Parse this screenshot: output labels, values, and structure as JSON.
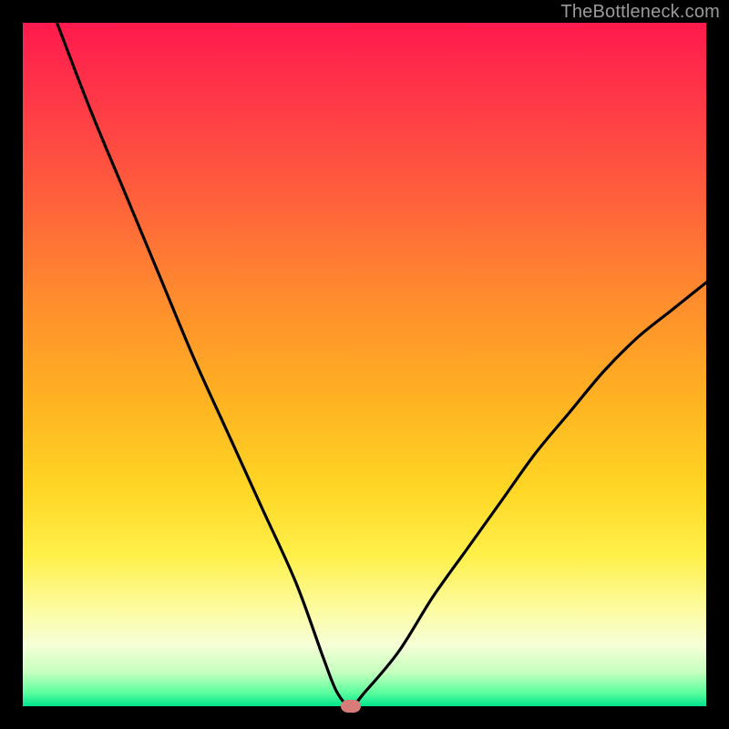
{
  "watermark": "TheBottleneck.com",
  "chart_data": {
    "type": "line",
    "title": "",
    "xlabel": "",
    "ylabel": "",
    "xlim": [
      0,
      100
    ],
    "ylim": [
      0,
      100
    ],
    "grid": false,
    "legend": false,
    "series": [
      {
        "name": "bottleneck-curve",
        "x": [
          5,
          10,
          15,
          20,
          25,
          30,
          35,
          40,
          44,
          46,
          48,
          50,
          55,
          60,
          65,
          70,
          75,
          80,
          85,
          90,
          95,
          100
        ],
        "values": [
          100,
          87,
          75,
          63,
          51,
          40,
          29,
          18,
          7,
          2,
          0,
          2,
          8,
          16,
          23,
          30,
          37,
          43,
          49,
          54,
          58,
          62
        ]
      }
    ],
    "annotations": [
      {
        "name": "minimum-marker",
        "x": 48,
        "y": 0
      }
    ],
    "background": {
      "type": "vertical-gradient",
      "stops": [
        {
          "pos": 0.0,
          "color": "#ff1a4d"
        },
        {
          "pos": 0.55,
          "color": "#ffb222"
        },
        {
          "pos": 0.86,
          "color": "#fdfca3"
        },
        {
          "pos": 1.0,
          "color": "#00e38c"
        }
      ]
    }
  }
}
